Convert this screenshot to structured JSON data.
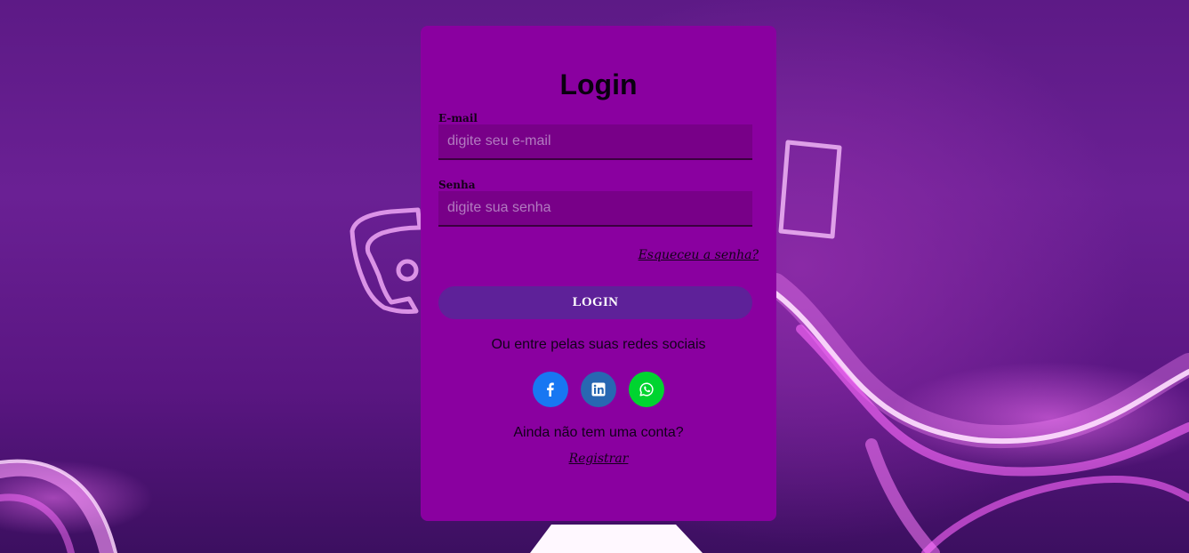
{
  "login_card": {
    "title": "Login",
    "email": {
      "label": "E-mail",
      "placeholder": "digite seu e-mail",
      "value": ""
    },
    "password": {
      "label": "Senha",
      "placeholder": "digite sua senha",
      "value": ""
    },
    "forgot_link": "Esqueceu a senha?",
    "login_button": "LOGIN",
    "social_prompt": "Ou entre pelas suas redes sociais",
    "socials": [
      {
        "icon": "facebook-icon",
        "color": "#1877f2"
      },
      {
        "icon": "linkedin-icon",
        "color": "#2867b2"
      },
      {
        "icon": "whatsapp-icon",
        "color": "#00d430"
      }
    ],
    "no_account_text": "Ainda não tem uma conta?",
    "register_link": "Registrar"
  },
  "colors": {
    "card_background": "#8a00a0",
    "input_background": "#780088",
    "login_button": "#5e2199",
    "page_background": "#5d1a86"
  }
}
